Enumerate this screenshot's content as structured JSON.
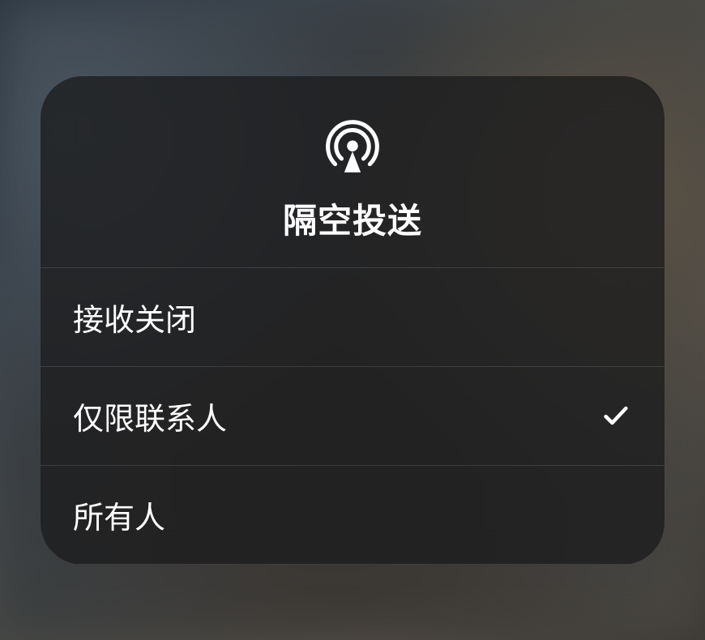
{
  "panel": {
    "title": "隔空投送",
    "options": [
      {
        "label": "接收关闭",
        "selected": false
      },
      {
        "label": "仅限联系人",
        "selected": true
      },
      {
        "label": "所有人",
        "selected": false
      }
    ]
  }
}
